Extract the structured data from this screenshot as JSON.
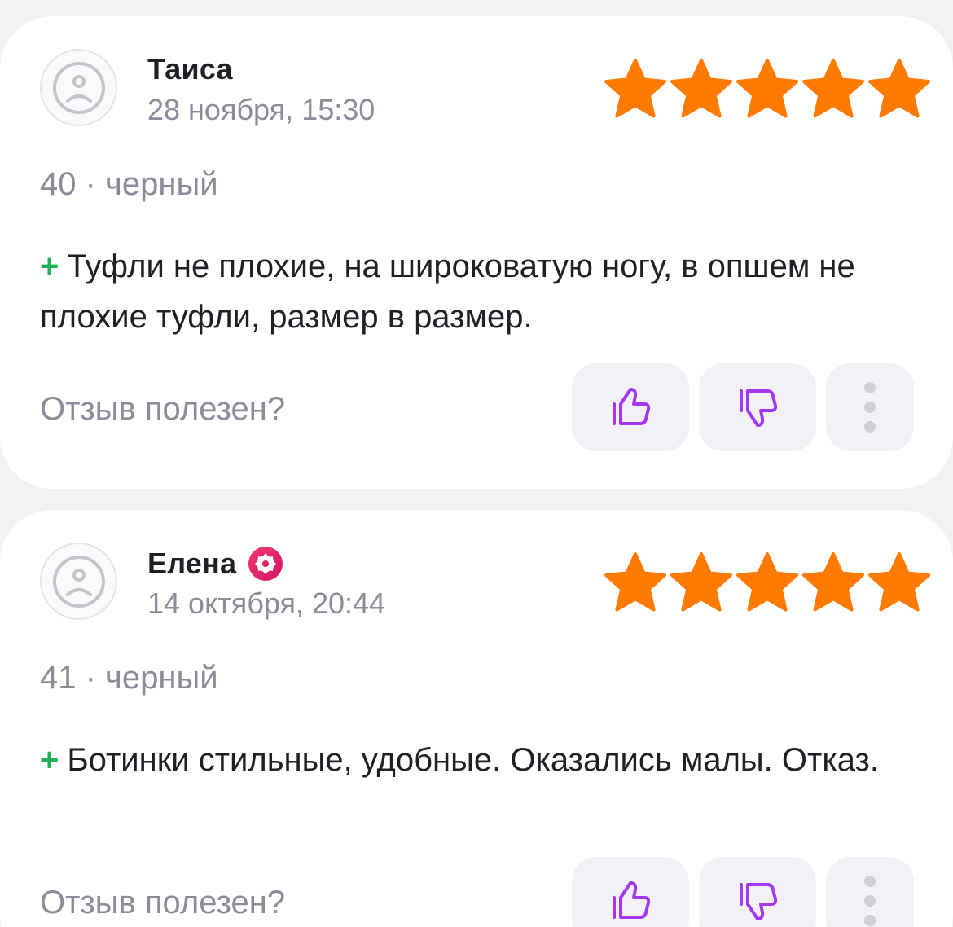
{
  "reviews": [
    {
      "author": "Таиса",
      "verified": false,
      "date": "28 ноября, 15:30",
      "rating": 5,
      "variant": "40 · черный",
      "plus_mark": "+",
      "text": "Туфли не плохие, на широковатую ногу,  в опшем не плохие туфли, размер в размер.",
      "helpful_question": "Отзыв полезен?"
    },
    {
      "author": "Елена",
      "verified": true,
      "date": "14 октября, 20:44",
      "rating": 5,
      "variant": "41 · черный",
      "plus_mark": "+",
      "text": "Ботинки стильные, удобные. Оказались малы. Отказ.",
      "helpful_question": "Отзыв полезен?"
    }
  ],
  "icons": {
    "avatar": "sad-face-icon",
    "star": "star-icon",
    "like": "thumbs-up-icon",
    "dislike": "thumbs-down-icon",
    "more": "more-vertical-icon",
    "badge": "flower-badge-icon"
  },
  "colors": {
    "star": "#ff7a00",
    "accent_purple": "#a338f0",
    "plus_green": "#22b158",
    "badge_gradient_start": "#f03a6e",
    "badge_gradient_end": "#d4146a"
  }
}
